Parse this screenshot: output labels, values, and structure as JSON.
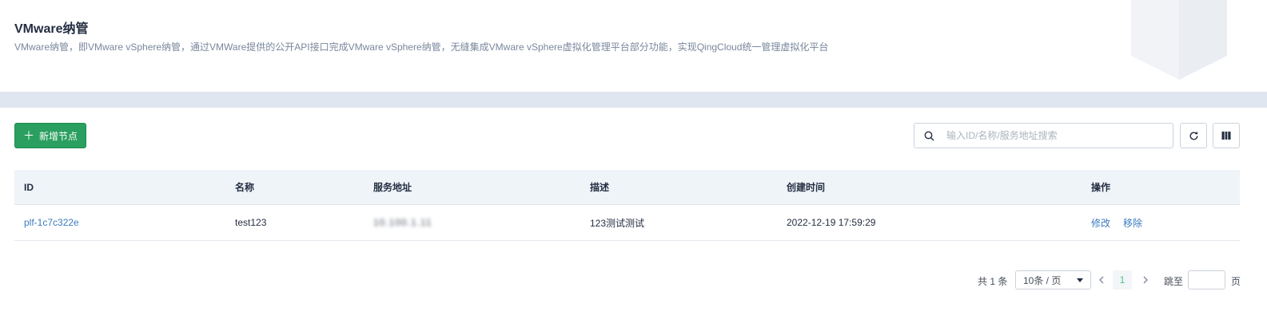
{
  "header": {
    "title": "VMware纳管",
    "description": "VMware纳管，即VMware vSphere纳管，通过VMWare提供的公开API接口完成VMware vSphere纳管，无缝集成VMware vSphere虚拟化管理平台部分功能，实现QingCloud统一管理虚拟化平台"
  },
  "toolbar": {
    "add_label": "新增节点",
    "search_placeholder": "输入ID/名称/服务地址搜索",
    "accent_color": "#2a9f5f"
  },
  "table": {
    "columns": [
      "ID",
      "名称",
      "服务地址",
      "描述",
      "创建时间",
      "操作"
    ],
    "rows": [
      {
        "id": "plf-1c7c322e",
        "name": "test123",
        "address": "10.100.1.11",
        "description": "123测试测试",
        "created": "2022-12-19 17:59:29",
        "actions": [
          "修改",
          "移除"
        ]
      }
    ]
  },
  "pagination": {
    "total_label": "共 1 条",
    "page_size_label": "10条 / 页",
    "current_page": "1",
    "jump_label": "跳至",
    "page_unit": "页"
  }
}
